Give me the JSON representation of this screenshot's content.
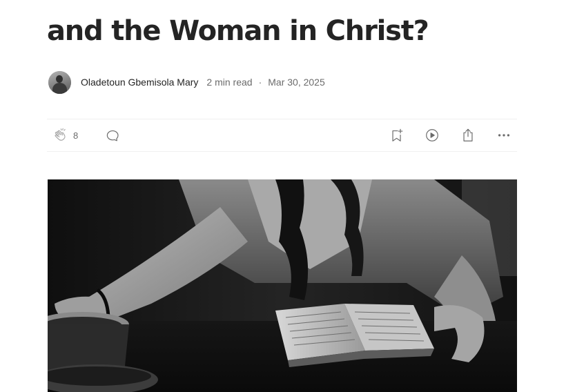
{
  "article": {
    "title": "and the Woman in Christ?",
    "author": "Oladetoun Gbemisola Mary",
    "read_time": "2 min read",
    "separator": "·",
    "date": "Mar 30, 2025"
  },
  "actions": {
    "clap_count": "8",
    "icons": [
      "clap-icon",
      "comment-icon",
      "bookmark-add-icon",
      "play-icon",
      "share-icon",
      "more-icon"
    ]
  },
  "hero_image": {
    "description": "monochrome photo"
  },
  "colors": {
    "text": "#242424",
    "muted": "#6b6b6b",
    "divider": "#f0f0f0"
  }
}
